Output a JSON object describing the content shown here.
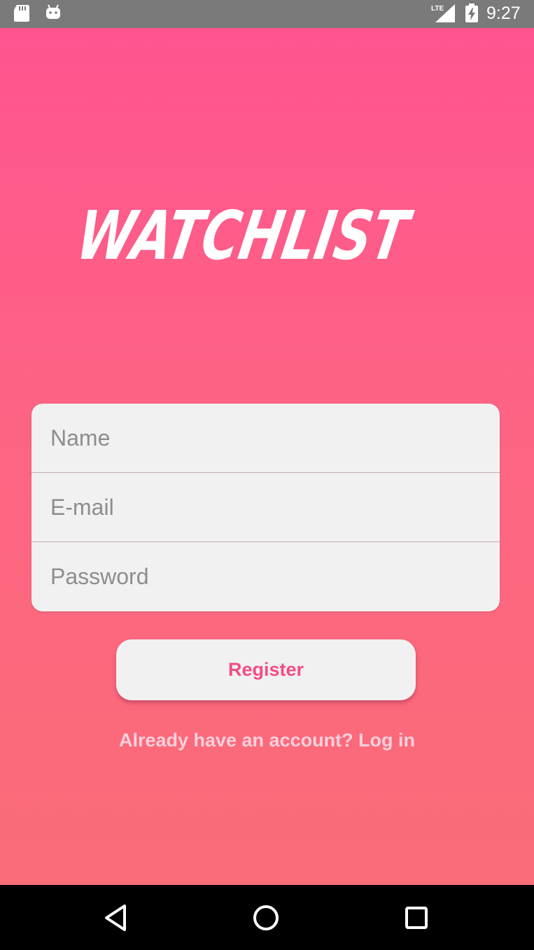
{
  "status_bar": {
    "time": "9:27",
    "network": "LTE",
    "icons": [
      "sd-card-icon",
      "android-icon",
      "lte-signal-icon",
      "battery-charging-icon"
    ]
  },
  "app": {
    "logo_text": "WATCHLIST",
    "background_gradient": [
      "#ff5490",
      "#fa6c77"
    ],
    "form": {
      "name_placeholder": "Name",
      "email_placeholder": "E-mail",
      "password_placeholder": "Password"
    },
    "register_label": "Register",
    "login_prompt": "Already have an account? Log in",
    "accent_color": "#f24d86"
  },
  "nav_bar": {
    "icons": [
      "back-triangle-icon",
      "home-circle-icon",
      "recents-square-icon"
    ]
  }
}
